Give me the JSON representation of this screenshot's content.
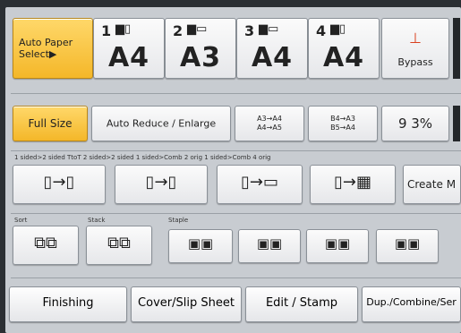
{
  "paper": {
    "auto_select_line1": "Auto Paper",
    "auto_select_line2": "Select▶",
    "trays": [
      {
        "num": "1",
        "size": "A4",
        "icons": "▆▯"
      },
      {
        "num": "2",
        "size": "A3",
        "icons": "▆▭"
      },
      {
        "num": "3",
        "size": "A4",
        "icons": "▆▭"
      },
      {
        "num": "4",
        "size": "A4",
        "icons": "▆▯"
      }
    ],
    "bypass_icon": "⊥",
    "bypass_label": "Bypass"
  },
  "ratio": {
    "full_size": "Full Size",
    "auto_reduce_enlarge": "Auto Reduce / Enlarge",
    "preset1_line1": "A3→A4",
    "preset1_line2": "A4→A5",
    "preset2_line1": "B4→A3",
    "preset2_line2": "B5→A4",
    "value": "9 3%"
  },
  "duplex": {
    "caption": "1 sided>2 sided TtoT   2 sided>2 sided   1 sided>Comb 2 orig   1 sided>Comb 4 orig",
    "create_margin": "Create M"
  },
  "finishing_row": {
    "sort_label": "Sort",
    "stack_label": "Stack",
    "staple_label": "Staple"
  },
  "tabs": {
    "finishing": "Finishing",
    "cover_slip": "Cover/Slip Sheet",
    "edit_stamp": "Edit / Stamp",
    "dup_combine": "Dup./Combine/Ser"
  },
  "colors": {
    "accent_yellow": "#f4b729",
    "panel": "#c8ccd1",
    "frame": "#2b2f33"
  }
}
